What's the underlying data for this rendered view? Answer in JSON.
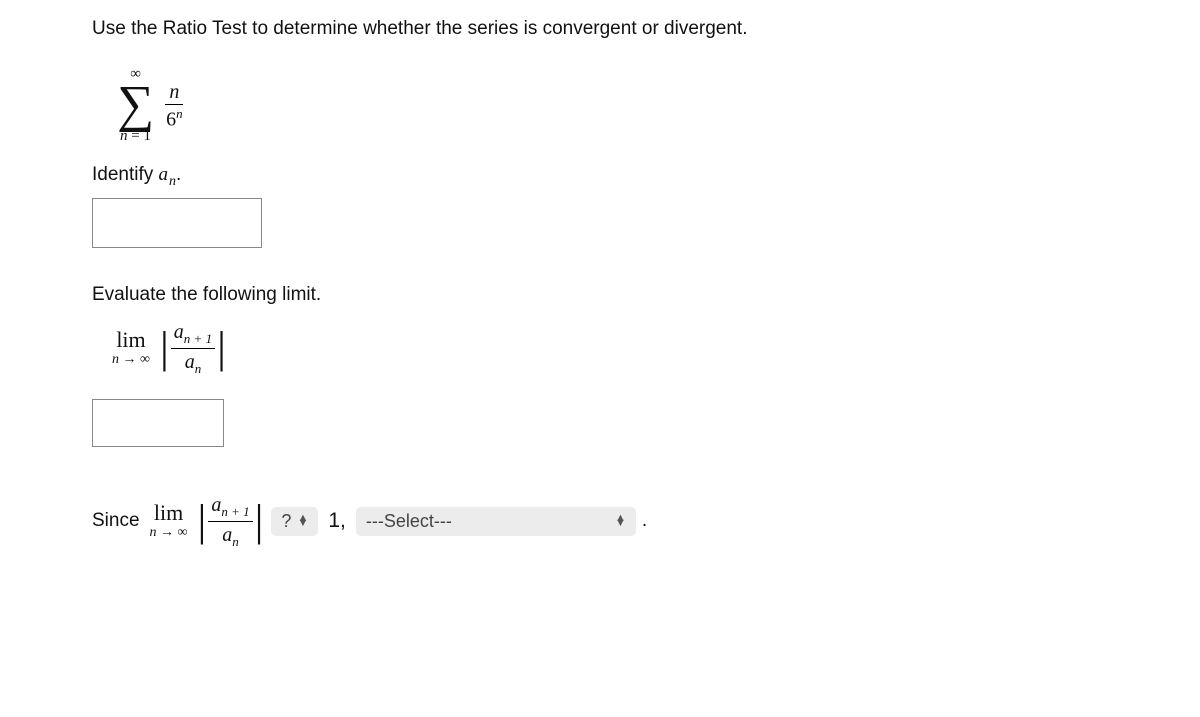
{
  "prompt": "Use the Ratio Test to determine whether the series is convergent or divergent.",
  "series": {
    "upper": "∞",
    "lower_var": "n",
    "lower_eq": "= 1",
    "numerator": "n",
    "denom_base": "6",
    "denom_exp": "n"
  },
  "identify": {
    "label_pre": "Identify ",
    "a": "a",
    "sub": "n",
    "period": ".",
    "answer": ""
  },
  "evaluate_heading": "Evaluate the following limit.",
  "lim": {
    "word": "lim",
    "under_var": "n",
    "under_arrow": " → ∞",
    "ratio_num_a": "a",
    "ratio_num_sub": "n + 1",
    "ratio_den_a": "a",
    "ratio_den_sub": "n",
    "answer": ""
  },
  "conclusion": {
    "since": "Since",
    "compare_q": "?",
    "one": "1,",
    "select_placeholder": "---Select---",
    "period": "."
  }
}
